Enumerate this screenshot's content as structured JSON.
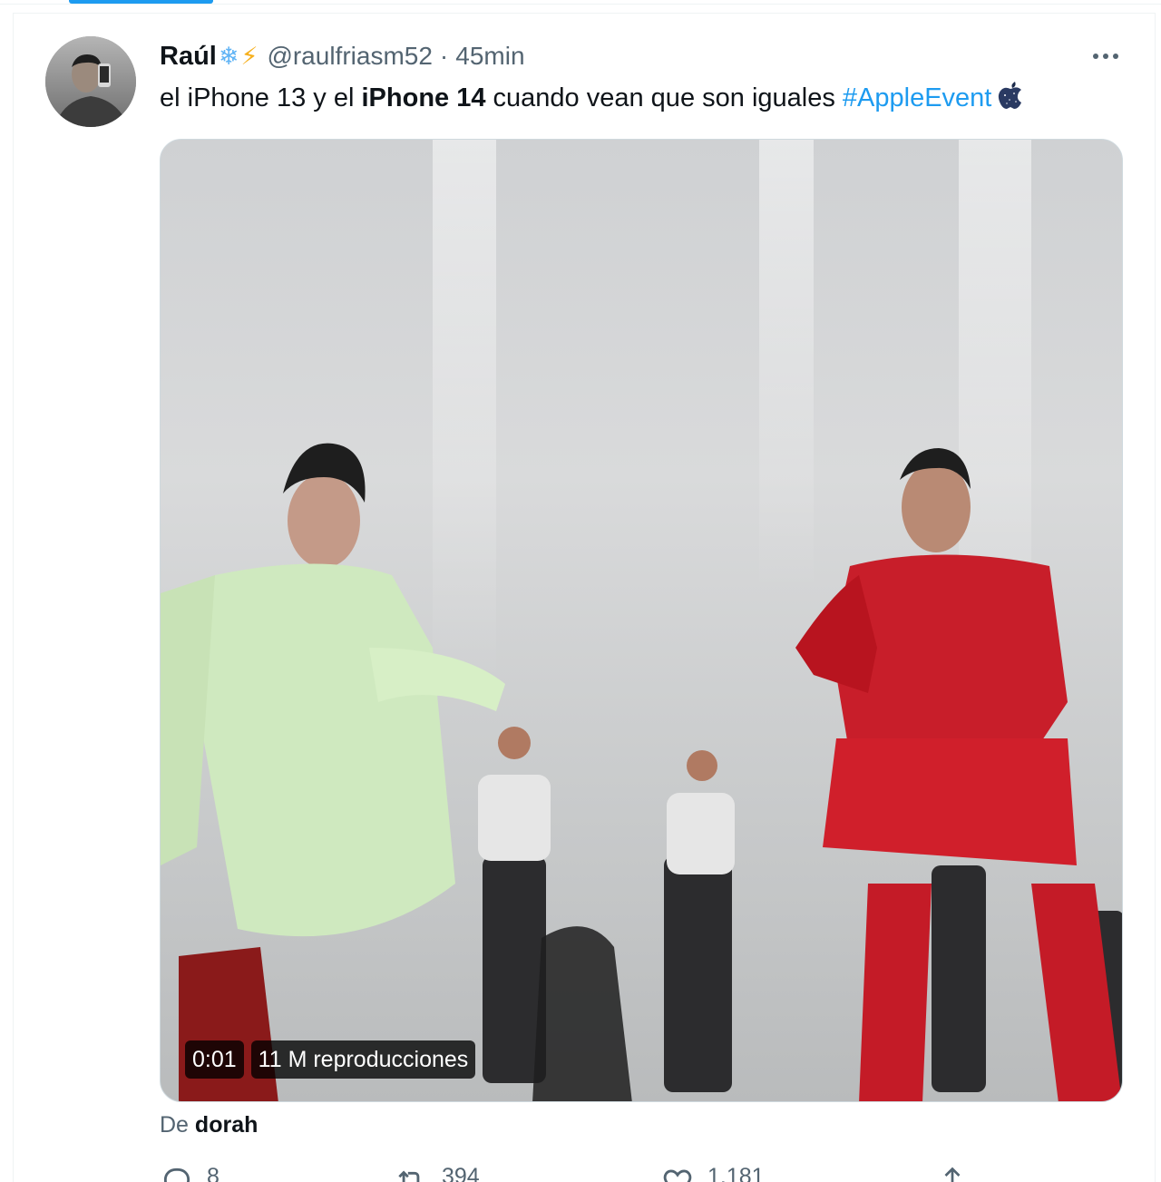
{
  "tweet": {
    "author": {
      "display_name": "Raúl",
      "name_emojis": [
        "snowflake-emoji",
        "lightning-emoji"
      ],
      "handle": "@raulfriasm52",
      "separator": "·",
      "time": "45min"
    },
    "text": {
      "part1": "el iPhone 13 y el ",
      "bold": "iPhone 14",
      "part2": " cuando vean que son iguales ",
      "hashtag": "#AppleEvent",
      "trailing_emoji": "apple-emoji"
    },
    "media": {
      "type": "video",
      "time": "0:01",
      "views": "11 M reproducciones"
    },
    "attribution": {
      "prefix": "De",
      "source": "dorah"
    },
    "actions": [
      {
        "name": "reply",
        "icon": "reply-icon",
        "count": "8"
      },
      {
        "name": "retweet",
        "icon": "retweet-icon",
        "count": "394"
      },
      {
        "name": "like",
        "icon": "heart-icon",
        "count": "1.181"
      },
      {
        "name": "share",
        "icon": "share-icon",
        "count": ""
      }
    ]
  },
  "colors": {
    "accent": "#1d9bf0",
    "text_primary": "#0f1419",
    "text_secondary": "#536471",
    "border": "#eff3f4"
  },
  "icons": [
    "more-icon",
    "snowflake-emoji",
    "lightning-emoji",
    "apple-emoji",
    "reply-icon",
    "retweet-icon",
    "heart-icon",
    "share-icon"
  ]
}
